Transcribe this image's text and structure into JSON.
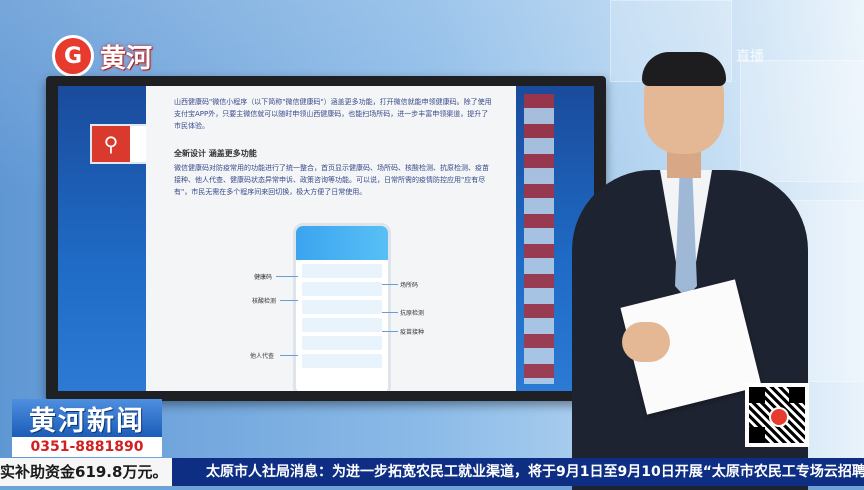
{
  "channel": {
    "logo_glyph": "G",
    "logo_text": "黄河",
    "corner_mark": "直播"
  },
  "screen": {
    "paragraph1": "山西健康码\"微信小程序（以下简称\"微信健康码\"）涵盖更多功能，打开微信就能申领健康码。除了使用支付宝APP外，只要主微信就可以随时申领山西健康码，也能扫场所码，进一步丰富申领渠道，提升了市民体验。",
    "heading": "全新设计  涵盖更多功能",
    "paragraph2": "微信健康码对防疫常用的功能进行了统一整合，首页显示健康码、场所码、核酸检测、抗原检测、疫苗接种、他人代查、健康码状态异常申诉、政策咨询等功能。可以说，日常所需的疫情防控应用\"应有尽有\"，市民无需在多个程序间来回切换，极大方便了日常使用。",
    "callouts": [
      "健康码",
      "核酸检测",
      "他人代查",
      "场所码",
      "抗原检测",
      "疫苗接种"
    ]
  },
  "news": {
    "title": "黄河新闻",
    "phone": "0351-8881890"
  },
  "ticker": {
    "left": "实补助资金619.8万元。",
    "main": "太原市人社局消息：为进一步拓宽农民工就业渠道，将于9月1日至9月10日开展“太原市农民工专场云招聘”"
  }
}
